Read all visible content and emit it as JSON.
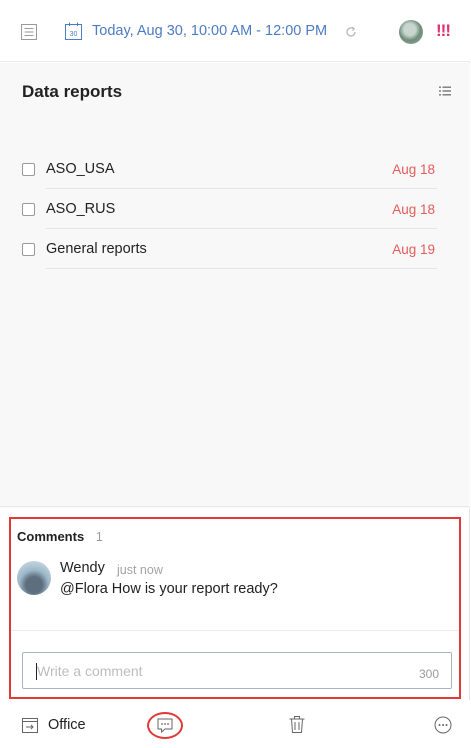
{
  "header": {
    "date_text": "Today, Aug 30, 10:00 AM - 12:00 PM",
    "calendar_day": "30",
    "priority_marker": "!!!"
  },
  "task": {
    "title": "Data reports",
    "subtasks": [
      {
        "name": "ASO_USA",
        "due": "Aug 18"
      },
      {
        "name": "ASO_RUS",
        "due": "Aug 18"
      },
      {
        "name": "General reports",
        "due": "Aug 19"
      }
    ]
  },
  "comments": {
    "label": "Comments",
    "count": "1",
    "items": [
      {
        "author": "Wendy",
        "time": "just now",
        "text": "@Flora How is your report ready?"
      }
    ],
    "input": {
      "placeholder": "Write a comment",
      "limit": "300"
    }
  },
  "footer": {
    "project": "Office"
  },
  "colors": {
    "accent_blue": "#4d7bc4",
    "due_red": "#e65a5a",
    "priority_pink": "#e0306f",
    "highlight_red": "#e13838"
  },
  "icons": [
    "menu-icon",
    "calendar-icon",
    "repeat-icon",
    "list-view-icon",
    "move-icon",
    "comment-icon",
    "trash-icon",
    "more-icon"
  ]
}
